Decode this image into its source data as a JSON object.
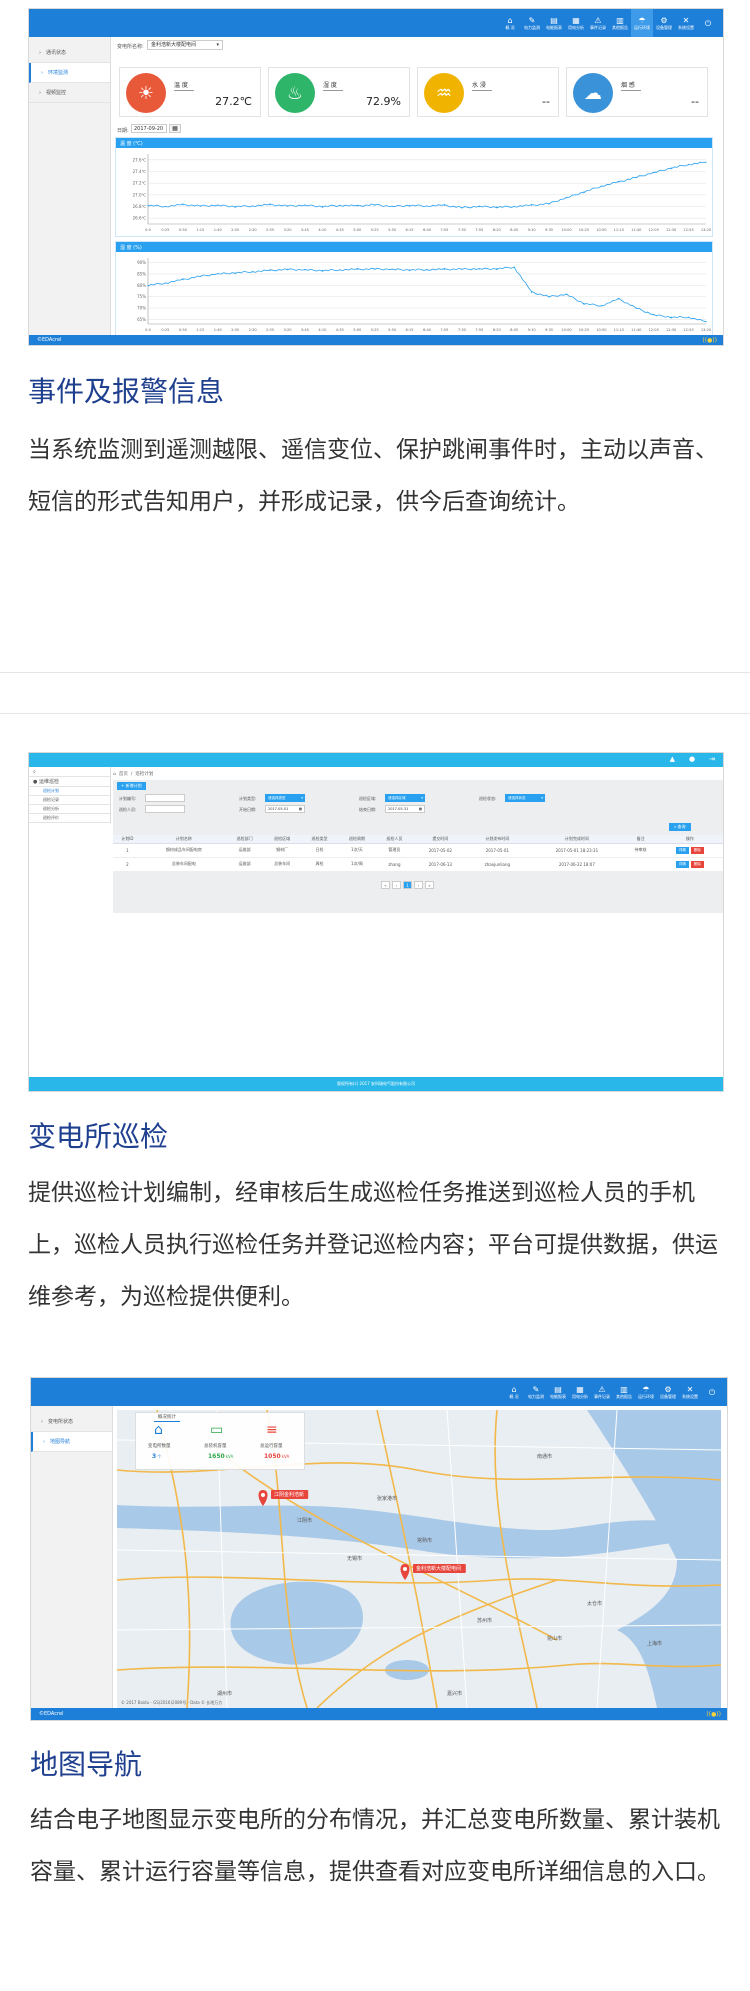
{
  "section1": {
    "screenshot": {
      "nav": [
        {
          "icon": "house-icon",
          "glyph": "⌂",
          "label": "概 况"
        },
        {
          "icon": "pen-icon",
          "glyph": "✎",
          "label": "电力监测"
        },
        {
          "icon": "report-icon",
          "glyph": "▤",
          "label": "电能报表"
        },
        {
          "icon": "chart-icon",
          "glyph": "▦",
          "label": "用电分析"
        },
        {
          "icon": "event-icon",
          "glyph": "⚠",
          "label": "事件记录"
        },
        {
          "icon": "doc-icon",
          "glyph": "▥",
          "label": "其他报告"
        },
        {
          "icon": "env-icon",
          "glyph": "☂",
          "label": "运行环境"
        },
        {
          "icon": "gear-icon",
          "glyph": "⚙",
          "label": "设备管理"
        },
        {
          "icon": "tools-icon",
          "glyph": "✕",
          "label": "系统设置"
        },
        {
          "icon": "power-icon",
          "glyph": "⏻",
          "label": ""
        }
      ],
      "sidebar": [
        "通讯状态",
        "环境监测",
        "视频监控"
      ],
      "selector_label": "变电所名称:",
      "selector_value": "金利浩新大楼配电间",
      "cards": [
        {
          "name": "温 度",
          "value": "27.2℃",
          "color": "#e8593a",
          "glyph": "☀"
        },
        {
          "name": "湿 度",
          "value": "72.9%",
          "color": "#2fb56a",
          "glyph": "♨"
        },
        {
          "name": "水 浸",
          "value": "--",
          "color": "#f0b400",
          "glyph": "♒"
        },
        {
          "name": "烟 感",
          "value": "--",
          "color": "#3a92d8",
          "glyph": "☁"
        }
      ],
      "date_label": "日期:",
      "date_value": "2017-09-20",
      "chart_titles": [
        "温 度 (℃)",
        "湿 度 (%)"
      ],
      "status_text": "©EDAcrel",
      "status_right": "((●))"
    },
    "heading": "事件及报警信息",
    "text": "当系统监测到遥测越限、遥信变位、保护跳闸事件时，主动以声音、短信的形式告知用户，并形成记录，供今后查询统计。"
  },
  "chart_data": [
    {
      "type": "line",
      "title": "温 度 (℃)",
      "ylabel": "",
      "y_ticks": [
        "27.6℃",
        "27.4℃",
        "27.2℃",
        "27.0℃",
        "26.8℃",
        "26.6℃"
      ],
      "ylim": [
        26.5,
        27.7
      ],
      "x_ticks": [
        "0:0",
        "0:25",
        "0:50",
        "1:15",
        "1:40",
        "2:05",
        "2:30",
        "2:55",
        "3:20",
        "3:45",
        "4:10",
        "4:35",
        "5:00",
        "5:25",
        "5:50",
        "6:15",
        "6:40",
        "7:05",
        "7:30",
        "7:55",
        "8:20",
        "8:45",
        "9:10",
        "9:35",
        "10:00",
        "10:25",
        "10:50",
        "11:15",
        "11:40",
        "12:05",
        "12:30",
        "12:55",
        "13:20"
      ],
      "series": [
        {
          "values": [
            26.82,
            26.8,
            26.83,
            26.81,
            26.82,
            26.8,
            26.81,
            26.83,
            26.81,
            26.82,
            26.8,
            26.82,
            26.81,
            26.83,
            26.8,
            26.82,
            26.81,
            26.82,
            26.78,
            26.8,
            26.79,
            26.8,
            26.82,
            26.85,
            26.95,
            27.05,
            27.15,
            27.22,
            27.3,
            27.38,
            27.46,
            27.52,
            27.56
          ]
        }
      ],
      "grid": true
    },
    {
      "type": "line",
      "title": "湿 度 (%)",
      "ylabel": "",
      "y_ticks": [
        "90%",
        "85%",
        "80%",
        "75%",
        "70%",
        "65%"
      ],
      "ylim": [
        63,
        92
      ],
      "x_ticks": [
        "0:0",
        "0:25",
        "0:50",
        "1:15",
        "1:40",
        "2:05",
        "2:30",
        "2:55",
        "3:20",
        "3:45",
        "4:10",
        "4:35",
        "5:00",
        "5:25",
        "5:50",
        "6:15",
        "6:40",
        "7:05",
        "7:30",
        "7:55",
        "8:20",
        "8:45",
        "9:10",
        "9:35",
        "10:00",
        "10:25",
        "10:50",
        "11:15",
        "11:40",
        "12:05",
        "12:30",
        "12:55",
        "13:20"
      ],
      "series": [
        {
          "values": [
            80,
            81,
            82.5,
            84,
            85,
            85.5,
            86,
            86.5,
            87,
            86.8,
            86.5,
            86.8,
            87,
            87.2,
            87,
            86.8,
            86.9,
            87,
            87.1,
            87.2,
            87.3,
            88,
            77,
            75,
            76,
            72,
            71,
            74,
            70,
            67,
            66,
            66,
            64
          ]
        }
      ],
      "grid": true
    }
  ],
  "section2": {
    "screenshot": {
      "top_icons": [
        "▲",
        "●",
        "⇥"
      ],
      "breadcrumb": [
        "首页",
        "巡检计划"
      ],
      "sidebar_header": "运维巡检",
      "sidebar": [
        "巡检计划",
        "巡检记录",
        "巡检分析",
        "巡检评价"
      ],
      "add_button": "+ 新增计划",
      "filters": [
        {
          "label": "计划编号:",
          "kind": "box"
        },
        {
          "label": "计划类型:",
          "kind": "select",
          "value": "请选择类型"
        },
        {
          "label": "巡检区域:",
          "kind": "select",
          "value": "请选择区域"
        },
        {
          "label": "巡检状态:",
          "kind": "select",
          "value": "请选择状态"
        },
        {
          "label": "巡检人员:",
          "kind": "box"
        },
        {
          "label": "开始日期:",
          "kind": "date",
          "value": "2017-05-01"
        },
        {
          "label": "结束日期:",
          "kind": "date",
          "value": "2017-05-31"
        }
      ],
      "search_button": "查询",
      "columns": [
        "计划ID",
        "计划名称",
        "巡检部门",
        "巡检区域",
        "巡检类型",
        "巡检周期",
        "巡检人员",
        "提交时间",
        "计划发布时间",
        "计划完成时间",
        "备注",
        "操作"
      ],
      "rows": [
        [
          "1",
          "钢材成品车间配电房",
          "运维部",
          "钢材厂",
          "日检",
          "1次/天",
          "管理员",
          "2017-05-02",
          "2017-05-01",
          "2017-05-01 18:23:31",
          "待审核",
          ""
        ],
        [
          "2",
          "总装车间配电",
          "运维部",
          "总装车间",
          "周检",
          "1次/周",
          "zhang",
          "2017-06-13",
          "zhaojunliang",
          "2017-06-22 18:07",
          "",
          ""
        ]
      ],
      "row_actions": [
        {
          "label": "详情",
          "color": "#29a1f0"
        },
        {
          "label": "删除",
          "color": "#e8453c"
        }
      ],
      "pager": [
        "«",
        "‹",
        "1",
        "›",
        "»"
      ],
      "footer": "版权所有(c) 2017 安科瑞电气股份有限公司"
    },
    "heading": "变电所巡检",
    "text": "提供巡检计划编制，经审核后生成巡检任务推送到巡检人员的手机上，巡检人员执行巡检任务并登记巡检内容；平台可提供数据，供运维参考，为巡检提供便利。"
  },
  "section3": {
    "screenshot": {
      "sidebar": [
        "变电所状态",
        "地图导航"
      ],
      "map_tab": "概况统计",
      "stats": [
        {
          "label": "变电所数量",
          "value": "3",
          "unit": "个",
          "color": "#1e7fd9",
          "glyph": "⌂"
        },
        {
          "label": "总装机容量",
          "value": "1650",
          "unit": "kVA",
          "color": "#2fa84a",
          "glyph": "▭"
        },
        {
          "label": "总运行容量",
          "value": "1050",
          "unit": "kVA",
          "color": "#e8453c",
          "glyph": "≡"
        }
      ],
      "markers": [
        "江阴金利浩新",
        "金利浩新大楼配电间"
      ],
      "map_labels": [
        "南通市",
        "常熟市",
        "苏州市",
        "太仓市",
        "昆山市",
        "上海市",
        "无锡市",
        "江阴市",
        "张家港市",
        "湖州市",
        "嘉兴市"
      ],
      "map_copyright": "© 2017 Baidu - GS(2016)2089号 - Data © 长地万方",
      "status_text": "©EDAcrel",
      "status_right": "((●))"
    },
    "heading": "地图导航",
    "text": "结合电子地图显示变电所的分布情况，并汇总变电所数量、累计装机容量、累计运行容量等信息，提供查看对应变电所详细信息的入口。"
  },
  "colors": {
    "accent": "#1e7fd9",
    "heading": "#1f3f8f",
    "sky": "#29a1f0"
  }
}
